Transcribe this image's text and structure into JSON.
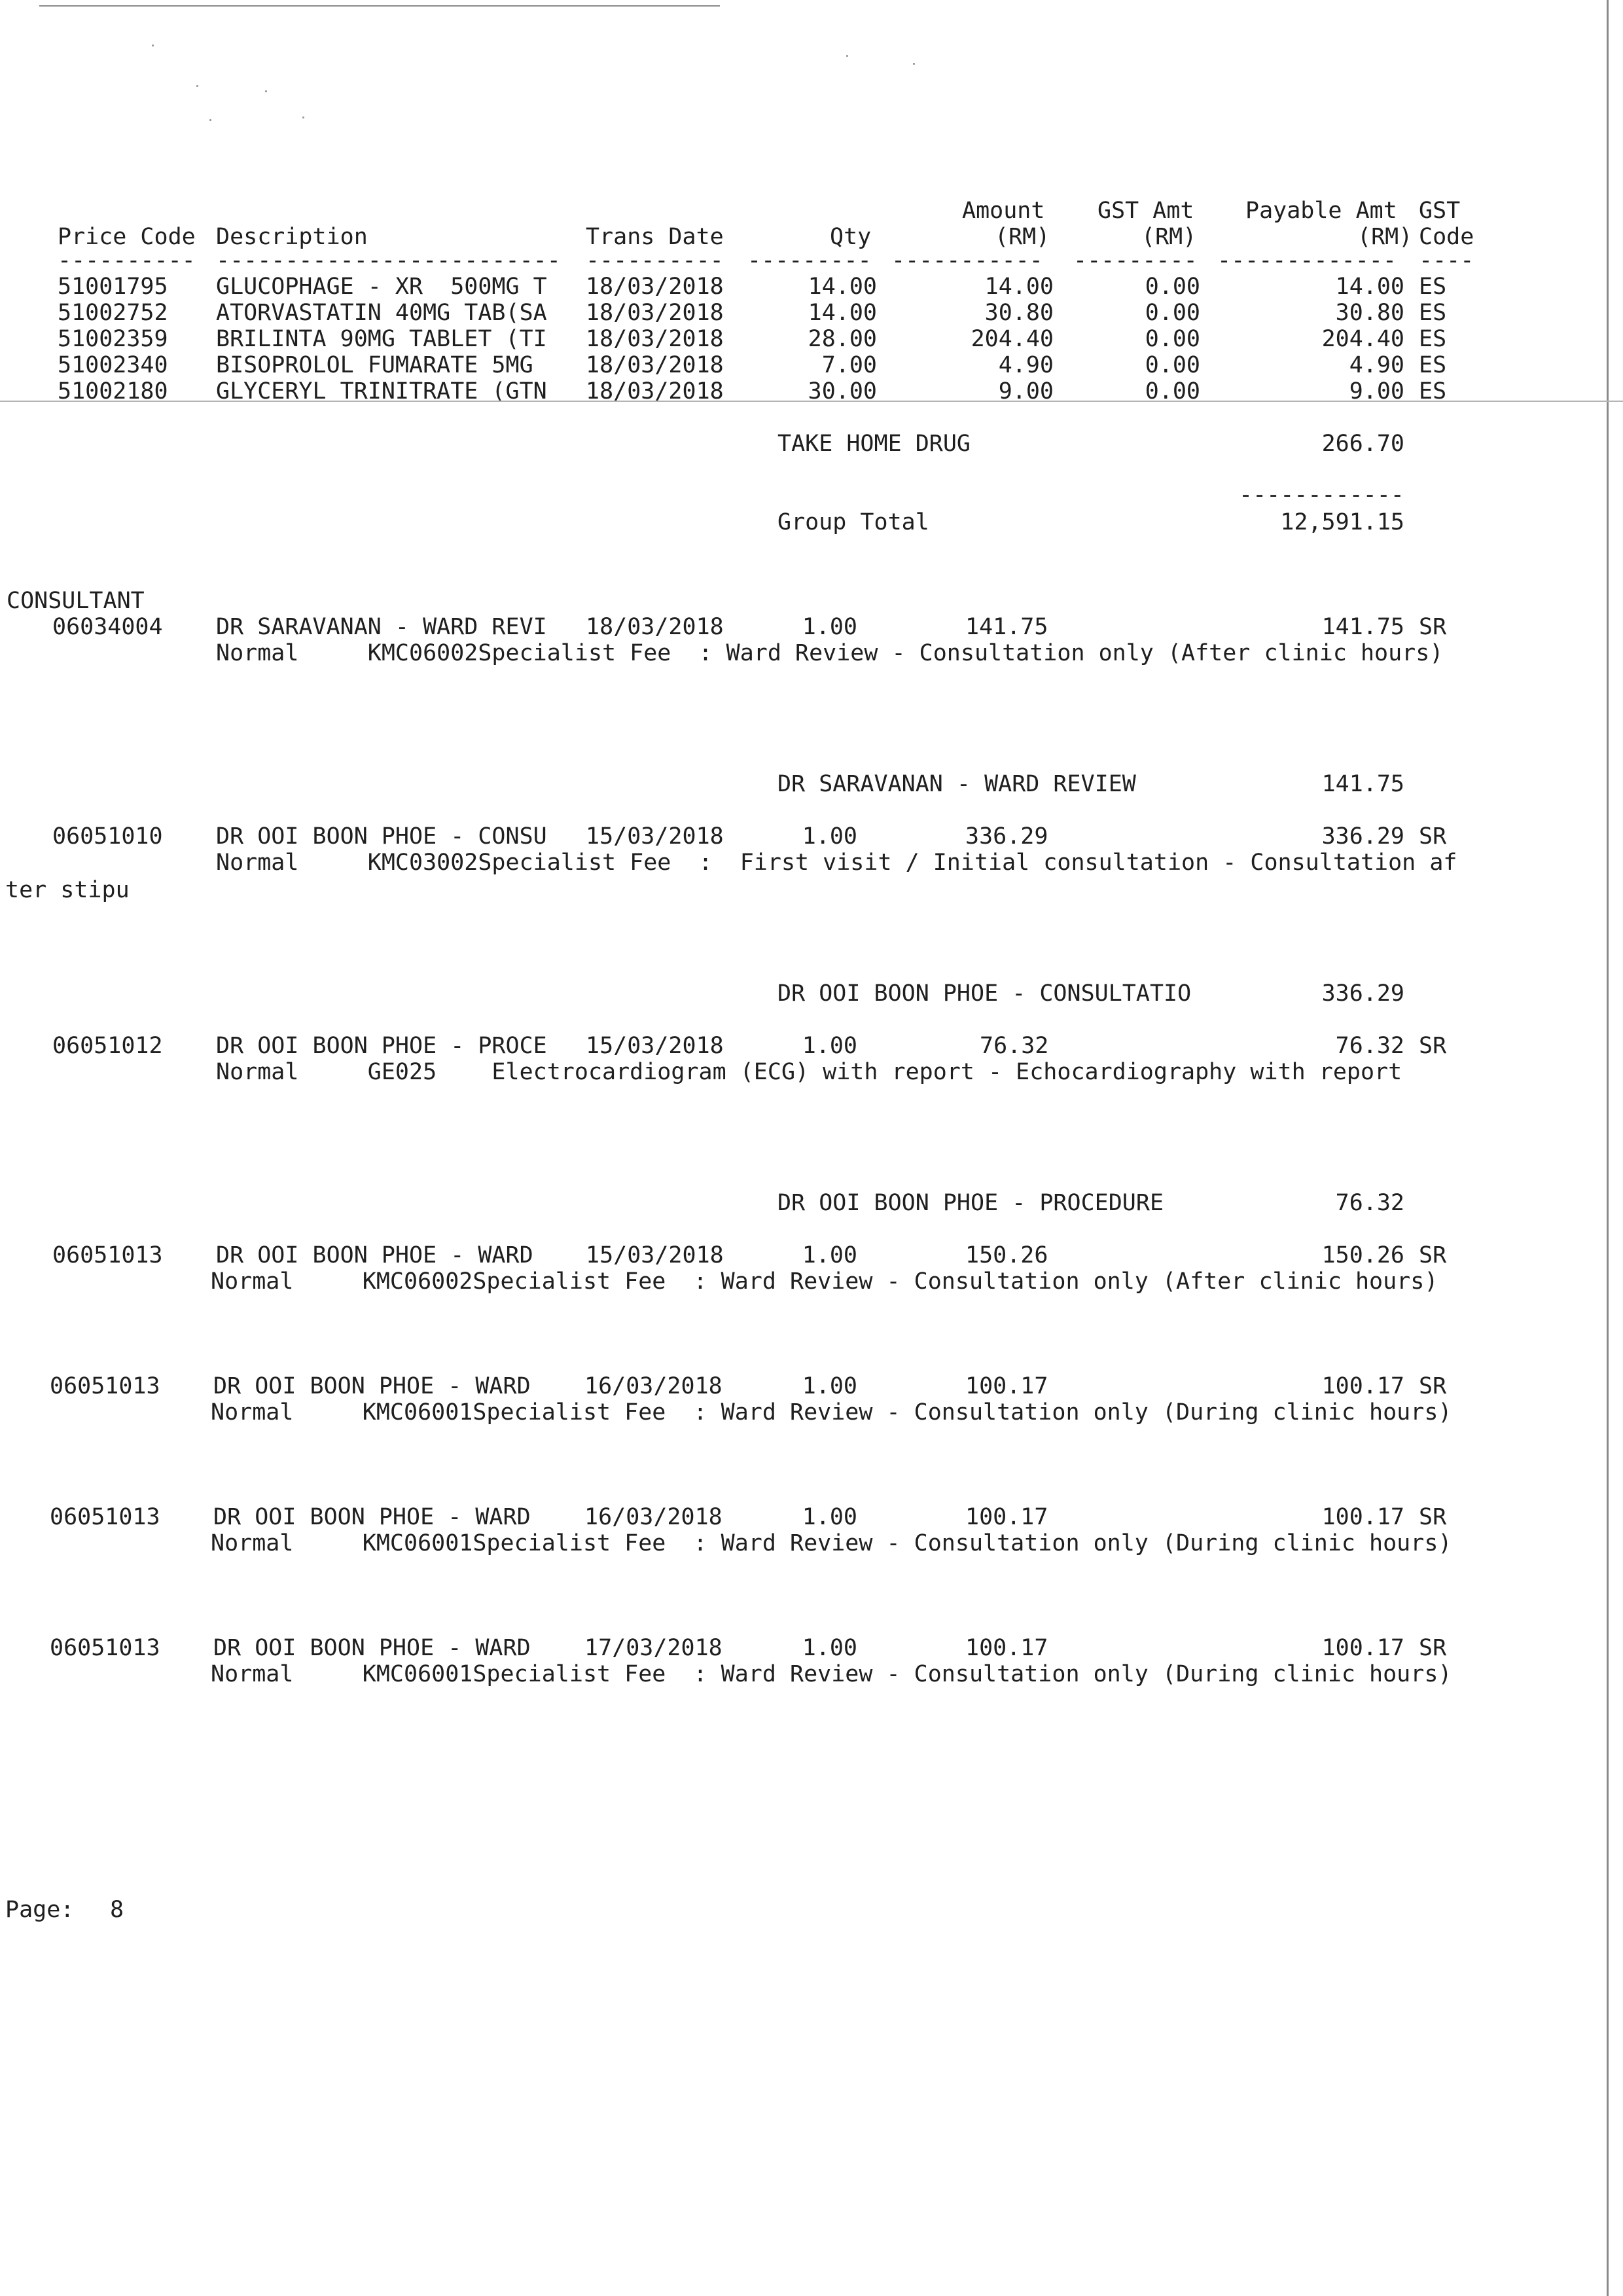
{
  "header": {
    "price_code": "Price Code",
    "description": "Description",
    "trans_date": "Trans Date",
    "qty": "Qty",
    "amount_1": "Amount",
    "amount_2": "(RM)",
    "gst_amt_1": "GST Amt",
    "gst_amt_2": "(RM)",
    "payable_1": "Payable Amt",
    "payable_2": "(RM)",
    "gst_code_1": "GST",
    "gst_code_2": "Code",
    "dash_code": "----------",
    "dash_desc": "-------------------------",
    "dash_date": "----------",
    "dash_qty": "---------",
    "dash_amt": "-----------",
    "dash_gst": "---------",
    "dash_pay": "-------------",
    "dash_gcode": "----"
  },
  "drugs": [
    {
      "code": "51001795",
      "desc": "GLUCOPHAGE - XR  500MG T",
      "date": "18/03/2018",
      "qty": "14.00",
      "amount": "14.00",
      "gst": "0.00",
      "payable": "14.00",
      "gst_code": "ES"
    },
    {
      "code": "51002752",
      "desc": "ATORVASTATIN 40MG TAB(SA",
      "date": "18/03/2018",
      "qty": "14.00",
      "amount": "30.80",
      "gst": "0.00",
      "payable": "30.80",
      "gst_code": "ES"
    },
    {
      "code": "51002359",
      "desc": "BRILINTA 90MG TABLET (TI",
      "date": "18/03/2018",
      "qty": "28.00",
      "amount": "204.40",
      "gst": "0.00",
      "payable": "204.40",
      "gst_code": "ES"
    },
    {
      "code": "51002340",
      "desc": "BISOPROLOL FUMARATE 5MG ",
      "date": "18/03/2018",
      "qty": "7.00",
      "amount": "4.90",
      "gst": "0.00",
      "payable": "4.90",
      "gst_code": "ES"
    },
    {
      "code": "51002180",
      "desc": "GLYCERYL TRINITRATE (GTN",
      "date": "18/03/2018",
      "qty": "30.00",
      "amount": "9.00",
      "gst": "0.00",
      "payable": "9.00",
      "gst_code": "ES"
    }
  ],
  "take_home": {
    "label": "TAKE HOME DRUG",
    "value": "266.70"
  },
  "group_total": {
    "dashes": "------------",
    "label": "Group Total",
    "value": "12,591.15"
  },
  "section_label": "CONSULTANT",
  "consultant": [
    {
      "code": "06034004",
      "desc": "DR SARAVANAN - WARD REVI",
      "date": "18/03/2018",
      "qty": "1.00",
      "amount": "141.75",
      "payable": "141.75",
      "gst_code": "SR",
      "detail": "Normal     KMC06002Specialist Fee  : Ward Review - Consultation only (After clinic hours)"
    },
    {
      "code": "06051010",
      "desc": "DR OOI BOON PHOE - CONSU",
      "date": "15/03/2018",
      "qty": "1.00",
      "amount": "336.29",
      "payable": "336.29",
      "gst_code": "SR",
      "detail": "Normal     KMC03002Specialist Fee  :  First visit / Initial consultation - Consultation af",
      "wrap": "ter stipu"
    },
    {
      "code": "06051012",
      "desc": "DR OOI BOON PHOE - PROCE",
      "date": "15/03/2018",
      "qty": "1.00",
      "amount": "76.32",
      "payable": "76.32",
      "gst_code": "SR",
      "detail": "Normal     GE025    Electrocardiogram (ECG) with report - Echocardiography with report"
    },
    {
      "code": "06051013",
      "desc": "DR OOI BOON PHOE - WARD ",
      "date": "15/03/2018",
      "qty": "1.00",
      "amount": "150.26",
      "payable": "150.26",
      "gst_code": "SR",
      "detail": "Normal     KMC06002Specialist Fee  : Ward Review - Consultation only (After clinic hours)"
    },
    {
      "code": "06051013",
      "desc": "DR OOI BOON PHOE - WARD ",
      "date": "16/03/2018",
      "qty": "1.00",
      "amount": "100.17",
      "payable": "100.17",
      "gst_code": "SR",
      "detail": "Normal     KMC06001Specialist Fee  : Ward Review - Consultation only (During clinic hours)"
    },
    {
      "code": "06051013",
      "desc": "DR OOI BOON PHOE - WARD ",
      "date": "16/03/2018",
      "qty": "1.00",
      "amount": "100.17",
      "payable": "100.17",
      "gst_code": "SR",
      "detail": "Normal     KMC06001Specialist Fee  : Ward Review - Consultation only (During clinic hours)"
    },
    {
      "code": "06051013",
      "desc": "DR OOI BOON PHOE - WARD ",
      "date": "17/03/2018",
      "qty": "1.00",
      "amount": "100.17",
      "payable": "100.17",
      "gst_code": "SR",
      "detail": "Normal     KMC06001Specialist Fee  : Ward Review - Consultation only (During clinic hours)"
    }
  ],
  "subtotals": [
    {
      "label": "DR SARAVANAN - WARD REVIEW",
      "value": "141.75"
    },
    {
      "label": "DR OOI BOON PHOE - CONSULTATIO",
      "value": "336.29"
    },
    {
      "label": "DR OOI BOON PHOE - PROCEDURE",
      "value": "76.32"
    }
  ],
  "footer": {
    "page_label": "Page:",
    "page_number": "8"
  }
}
